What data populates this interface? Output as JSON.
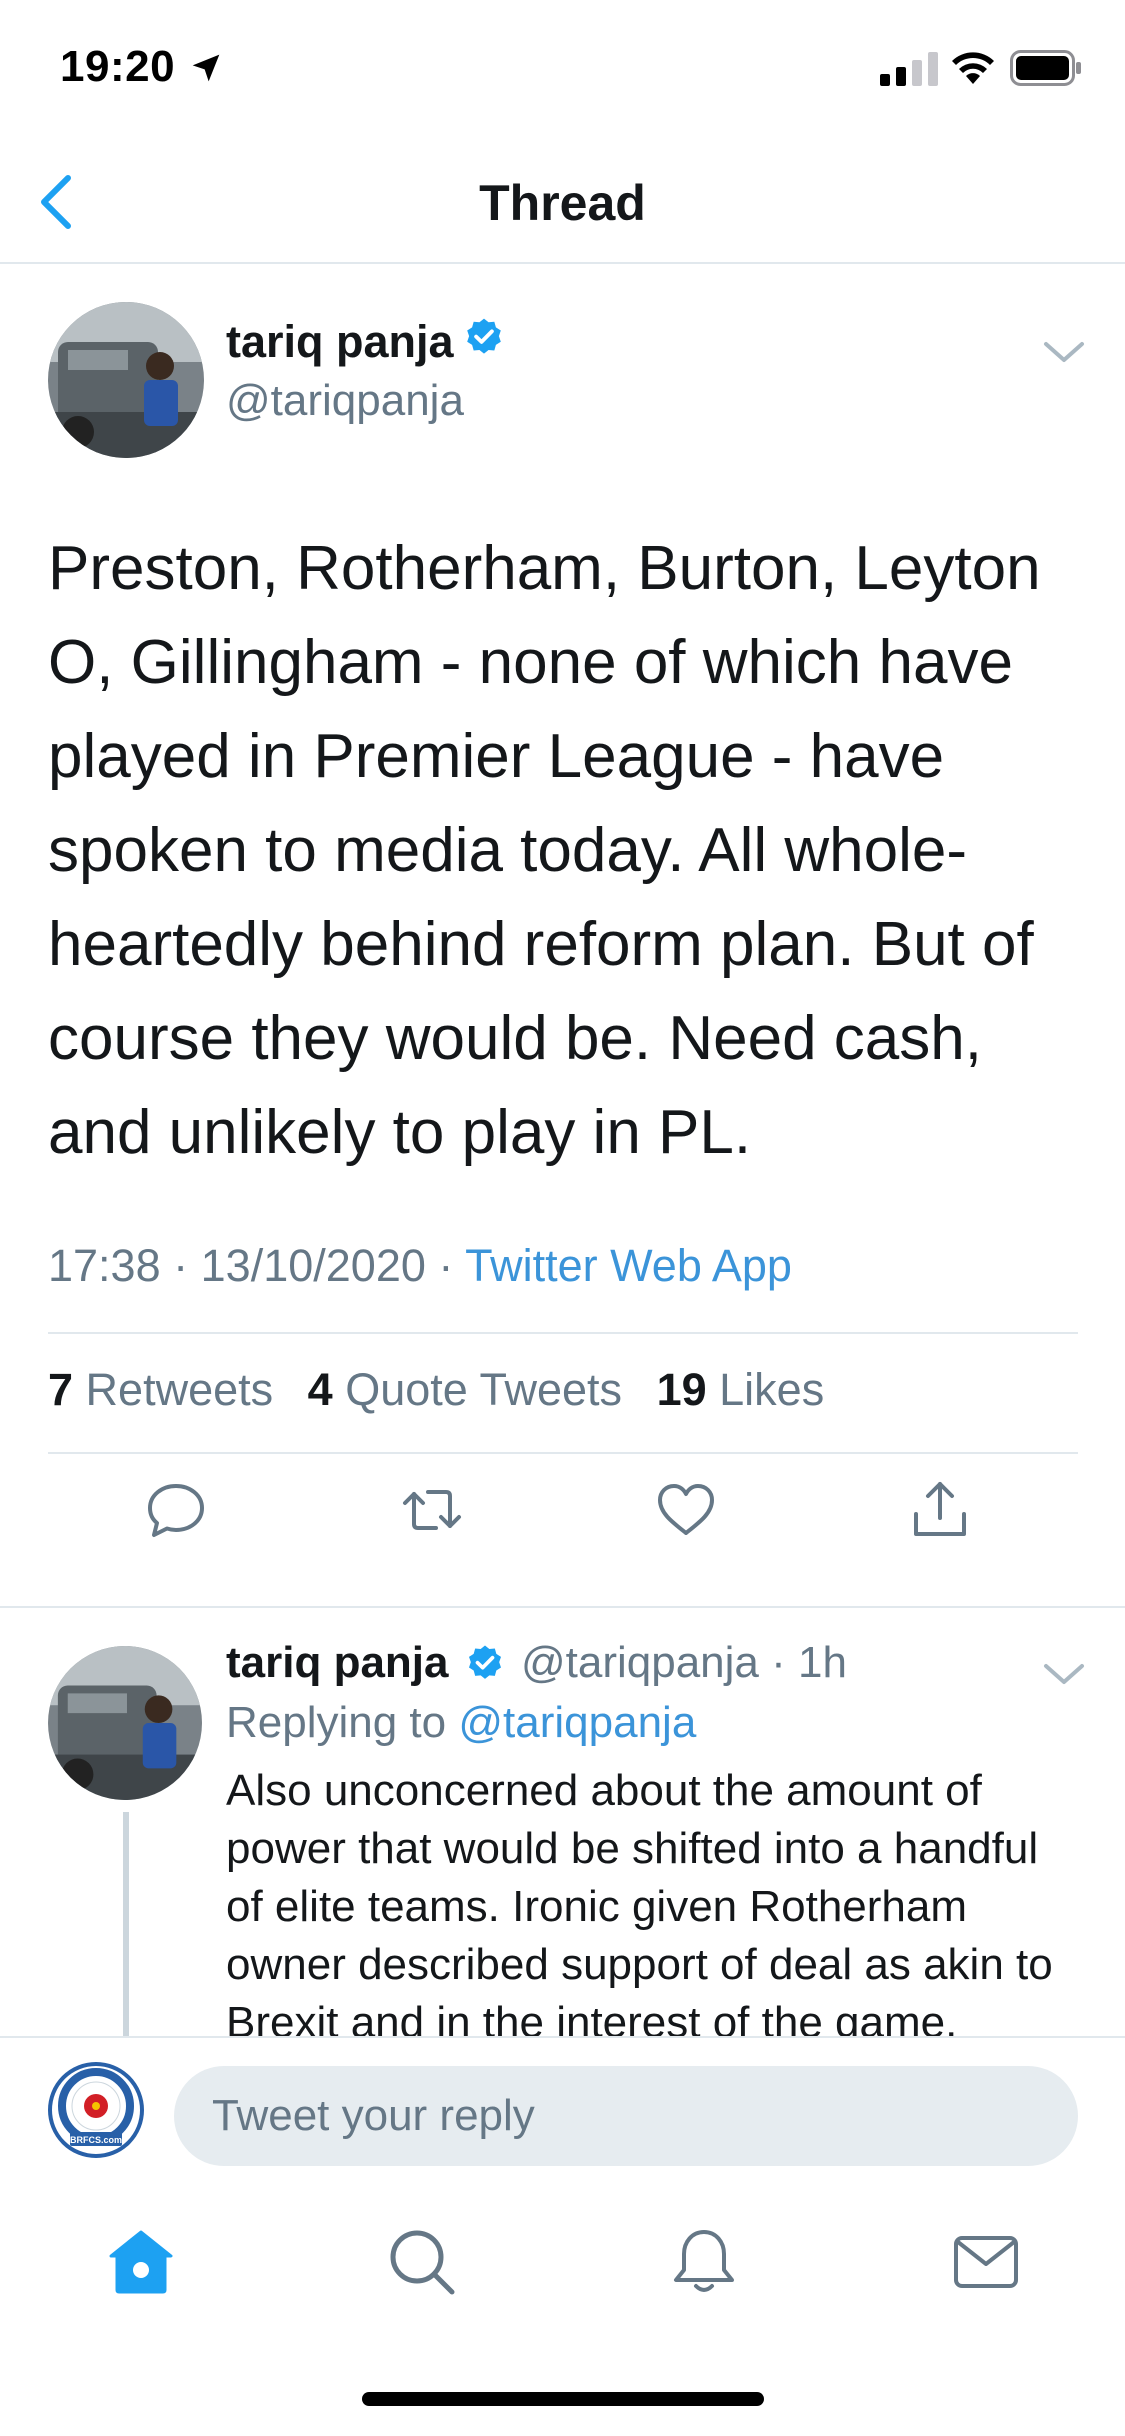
{
  "status_bar": {
    "time": "19:20"
  },
  "nav": {
    "title": "Thread"
  },
  "main_tweet": {
    "author_name": "tariq panja",
    "handle": "@tariqpanja",
    "text": "Preston, Rotherham, Burton, Leyton O, Gillingham - none of which have played in Premier League - have spoken to media today. All whole-heartedly behind reform plan. But of course they would be. Need cash, and unlikely to play in PL.",
    "time": "17:38",
    "date": "13/10/2020",
    "separator": "·",
    "source": "Twitter Web App",
    "stats": {
      "retweets_count": "7",
      "retweets_label": "Retweets",
      "quotes_count": "4",
      "quotes_label": "Quote Tweets",
      "likes_count": "19",
      "likes_label": "Likes"
    }
  },
  "reply_tweet": {
    "author_name": "tariq panja",
    "handle_time": "@tariqpanja · 1h",
    "replying_prefix": "Replying to",
    "replying_to": "@tariqpanja",
    "text": "Also unconcerned about the amount of power that would be shifted into a handful of elite teams. Ironic given Rotherham owner described support of deal as akin to Brexit and in the interest of the game."
  },
  "compose": {
    "placeholder": "Tweet your reply",
    "avatar_badge_text": "BRFCS.com"
  },
  "colors": {
    "accent": "#1da1f2",
    "link": "#3b94d9",
    "secondary_text": "#657786",
    "divider": "#e1e8ed"
  },
  "icons": {
    "actions": [
      "reply-icon",
      "retweet-icon",
      "like-icon",
      "share-icon"
    ],
    "tabs": [
      "home-icon",
      "search-icon",
      "notifications-icon",
      "messages-icon"
    ]
  }
}
